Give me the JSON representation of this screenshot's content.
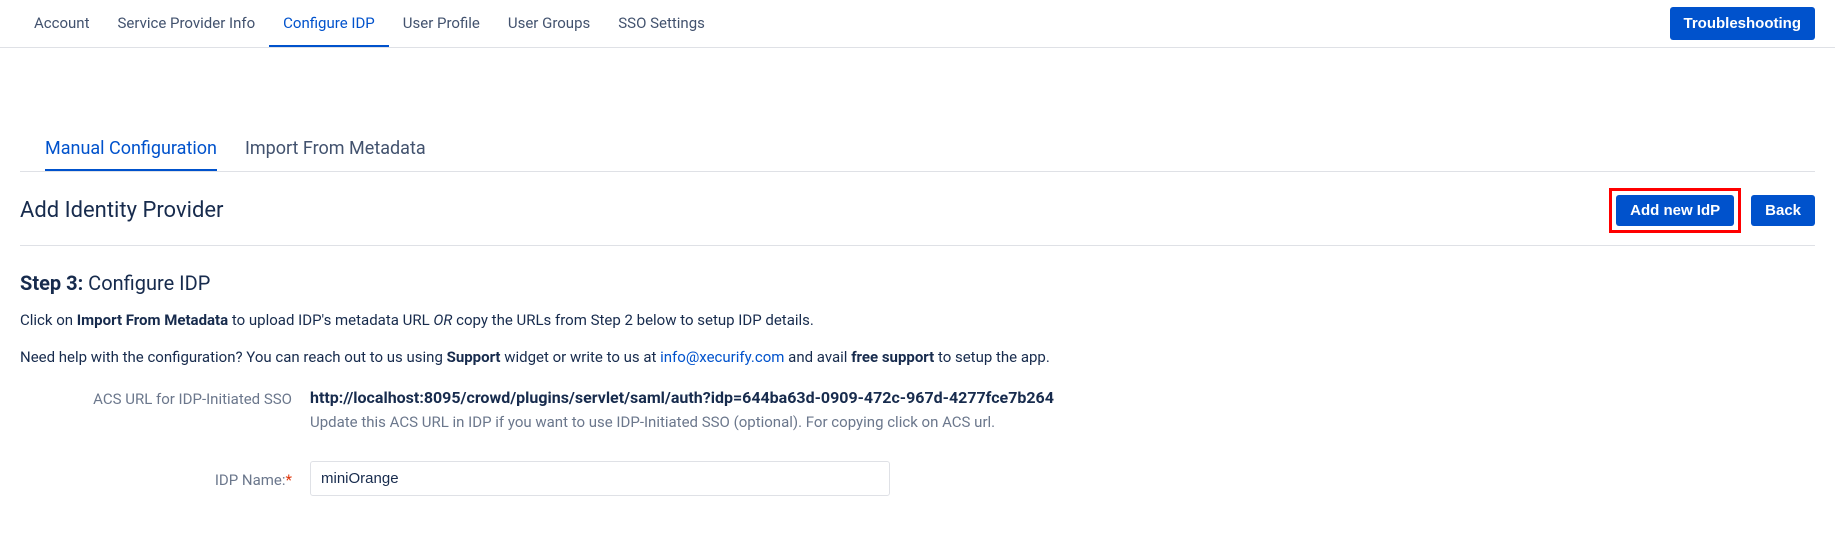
{
  "topNav": {
    "tabs": [
      {
        "label": "Account"
      },
      {
        "label": "Service Provider Info"
      },
      {
        "label": "Configure IDP"
      },
      {
        "label": "User Profile"
      },
      {
        "label": "User Groups"
      },
      {
        "label": "SSO Settings"
      }
    ],
    "troubleshootLabel": "Troubleshooting"
  },
  "subTabs": {
    "manual": "Manual Configuration",
    "import": "Import From Metadata"
  },
  "header": {
    "title": "Add Identity Provider",
    "addNew": "Add new IdP",
    "back": "Back"
  },
  "step": {
    "prefix": "Step 3:",
    "title": " Configure IDP",
    "line1_a": "Click on ",
    "line1_b": "Import From Metadata",
    "line1_c": " to upload IDP's metadata URL ",
    "line1_d": "OR",
    "line1_e": " copy the URLs from Step 2 below to setup IDP details.",
    "line2_a": "Need help with the configuration? You can reach out to us using ",
    "line2_b": "Support",
    "line2_c": " widget or write to us at ",
    "line2_email": "info@xecurify.com",
    "line2_d": " and avail ",
    "line2_e": "free support",
    "line2_f": " to setup the app."
  },
  "form": {
    "acsLabel": "ACS URL for IDP-Initiated SSO",
    "acsUrl": "http://localhost:8095/crowd/plugins/servlet/saml/auth?idp=644ba63d-0909-472c-967d-4277fce7b264",
    "acsNote": "Update this ACS URL in IDP if you want to use IDP-Initiated SSO (optional). For copying click on ACS url.",
    "idpNameLabel": "IDP Name:",
    "idpNameValue": "miniOrange"
  }
}
